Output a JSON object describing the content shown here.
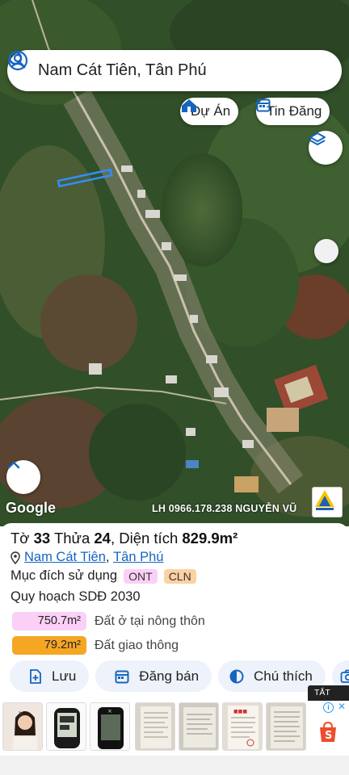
{
  "search": {
    "value": "Nam Cát Tiên, Tân Phú"
  },
  "chips": {
    "projects": "Dự Án",
    "listings": "Tin Đăng"
  },
  "map": {
    "attribution": "Google",
    "watermark": "LH 0966.178.238 NGUYỄN VŨ"
  },
  "parcel": {
    "sheet_label": "Tờ",
    "sheet": "33",
    "plot_label": "Thửa",
    "plot": "24",
    "area_label": ", Diện tích",
    "area": "829.9m²",
    "commune": "Nam Cát Tiên",
    "separator": ",",
    "district": "Tân Phú",
    "purpose_label": "Mục đích sử dụng",
    "purpose_tags": [
      "ONT",
      "CLN"
    ],
    "plan_label": "Quy hoạch SDĐ 2030",
    "zones": [
      {
        "value": "750.7m²",
        "label": "Đất ở tại nông thôn",
        "color": "#fbd0f7"
      },
      {
        "value": "79.2m²",
        "label": "Đất giao thông",
        "color": "#f5a623"
      }
    ]
  },
  "actions": {
    "save": "Lưu",
    "post": "Đăng bán",
    "legend": "Chú thích"
  },
  "ad": {
    "close_label": "TẮT QC"
  },
  "colors": {
    "accent": "#1565c0",
    "road_highlight": "#2f8fff"
  }
}
